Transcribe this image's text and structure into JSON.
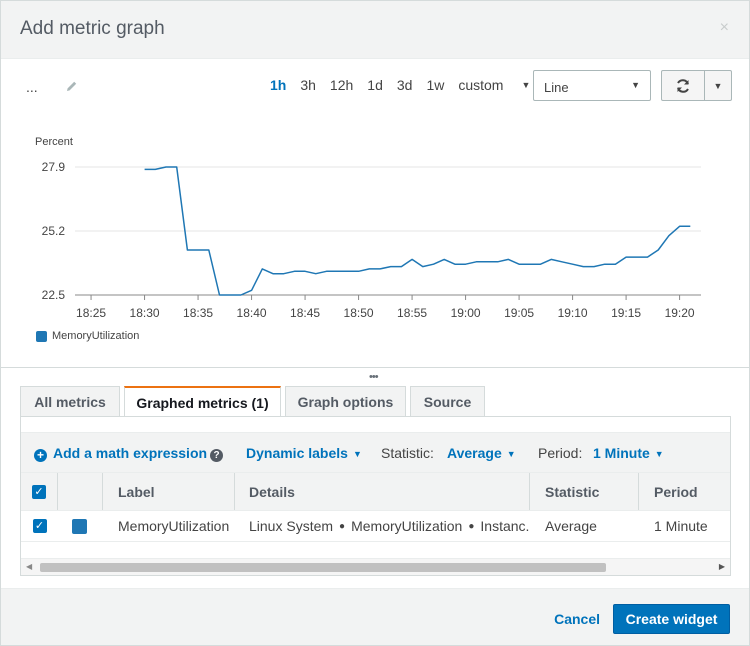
{
  "dialog": {
    "title": "Add metric graph",
    "close_icon": "×"
  },
  "graph_title": "...",
  "time_ranges": [
    "1h",
    "3h",
    "12h",
    "1d",
    "3d",
    "1w"
  ],
  "time_range_active": "1h",
  "time_range_custom": "custom",
  "graph_type": "Line",
  "chart_data": {
    "type": "line",
    "ylabel": "Percent",
    "y_ticks": [
      27.9,
      25.2,
      22.5
    ],
    "ylim": [
      22.5,
      27.9
    ],
    "x_ticks": [
      "18:25",
      "18:30",
      "18:35",
      "18:40",
      "18:45",
      "18:50",
      "18:55",
      "19:00",
      "19:05",
      "19:10",
      "19:15",
      "19:20"
    ],
    "legend_position": "bottom-left",
    "series": [
      {
        "name": "MemoryUtilization",
        "color": "#1f77b4",
        "x": [
          "18:30",
          "18:31",
          "18:32",
          "18:33",
          "18:34",
          "18:35",
          "18:36",
          "18:37",
          "18:38",
          "18:39",
          "18:40",
          "18:41",
          "18:42",
          "18:43",
          "18:44",
          "18:45",
          "18:46",
          "18:47",
          "18:48",
          "18:49",
          "18:50",
          "18:51",
          "18:52",
          "18:53",
          "18:54",
          "18:55",
          "18:56",
          "18:57",
          "18:58",
          "18:59",
          "19:00",
          "19:01",
          "19:02",
          "19:03",
          "19:04",
          "19:05",
          "19:06",
          "19:07",
          "19:08",
          "19:09",
          "19:10",
          "19:11",
          "19:12",
          "19:13",
          "19:14",
          "19:15",
          "19:16",
          "19:17",
          "19:18",
          "19:19",
          "19:20",
          "19:21"
        ],
        "values": [
          27.8,
          27.8,
          27.9,
          27.9,
          24.4,
          24.4,
          24.4,
          22.5,
          22.5,
          22.5,
          22.7,
          23.6,
          23.4,
          23.4,
          23.5,
          23.5,
          23.4,
          23.5,
          23.5,
          23.5,
          23.5,
          23.6,
          23.6,
          23.7,
          23.7,
          24.0,
          23.7,
          23.8,
          24.0,
          23.8,
          23.8,
          23.9,
          23.9,
          23.9,
          24.0,
          23.8,
          23.8,
          23.8,
          24.0,
          23.9,
          23.8,
          23.7,
          23.7,
          23.8,
          23.8,
          24.1,
          24.1,
          24.1,
          24.4,
          25.0,
          25.4,
          25.4
        ]
      }
    ]
  },
  "legend_label": "MemoryUtilization",
  "tabs": [
    "All metrics",
    "Graphed metrics (1)",
    "Graph options",
    "Source"
  ],
  "active_tab": "Graphed metrics (1)",
  "actions": {
    "add_math": "Add a math expression",
    "dynamic_labels": "Dynamic labels",
    "statistic_label": "Statistic:",
    "statistic_value": "Average",
    "period_label": "Period:",
    "period_value": "1 Minute"
  },
  "table": {
    "columns": [
      "Label",
      "Details",
      "Statistic",
      "Period"
    ],
    "rows": [
      {
        "label": "MemoryUtilization",
        "details": [
          "Linux System",
          "MemoryUtilization",
          "Instanc..."
        ],
        "statistic": "Average",
        "period": "1 Minute"
      }
    ]
  },
  "footer": {
    "cancel": "Cancel",
    "create": "Create widget"
  }
}
